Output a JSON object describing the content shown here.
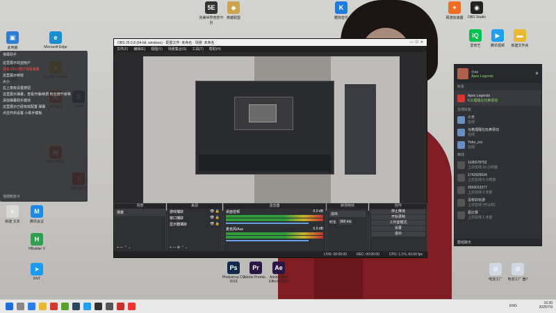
{
  "desktop_icons": [
    {
      "label": "此电脑",
      "color": "#2d7dd2",
      "glyph": "▣",
      "pos": "a"
    },
    {
      "label": "Microsoft Edge",
      "color": "#1a8fce",
      "glyph": "e",
      "pos": "b"
    },
    {
      "label": "回收站",
      "color": "#6f7c8a",
      "glyph": "♻",
      "pos": "c"
    },
    {
      "label": "Google Chrome",
      "color": "#d9a21b",
      "glyph": "●",
      "pos": "d"
    },
    {
      "label": "火绒安全",
      "color": "#c9572e",
      "glyph": "火",
      "pos": "e"
    },
    {
      "label": "Steam",
      "color": "#2a475e",
      "glyph": "S",
      "pos": "f"
    },
    {
      "label": "WPS Office",
      "color": "#d23a2f",
      "glyph": "W",
      "pos": "g"
    },
    {
      "label": "网易云音乐",
      "color": "#c5302c",
      "glyph": "♫",
      "pos": "h"
    },
    {
      "label": "新建 文本",
      "color": "#d9d9d9",
      "glyph": "≡",
      "pos": "i"
    },
    {
      "label": "腾讯会议",
      "color": "#1e88e5",
      "glyph": "M",
      "pos": "j"
    },
    {
      "label": "HBuilder X",
      "color": "#2e9e4f",
      "glyph": "H",
      "pos": "k"
    },
    {
      "label": "KNT",
      "color": "#1d9bf0",
      "glyph": "➤",
      "pos": "l"
    },
    {
      "label": "酷狗音乐",
      "color": "#1f7be0",
      "glyph": "K",
      "pos": "m"
    },
    {
      "label": "完美世界竞技平台",
      "color": "#333",
      "glyph": "5E",
      "pos": "n"
    },
    {
      "label": "英雄联盟",
      "color": "#c9a64d",
      "glyph": "◆",
      "pos": "o"
    },
    {
      "label": "网游加速器",
      "color": "#ef6c22",
      "glyph": "✦",
      "pos": "p"
    },
    {
      "label": "OBS Studio",
      "color": "#222",
      "glyph": "◉",
      "pos": "q"
    },
    {
      "label": "爱奇艺",
      "color": "#00c050",
      "glyph": "iQ",
      "pos": "r"
    },
    {
      "label": "腾讯视频",
      "color": "#1fa0f0",
      "glyph": "▶",
      "pos": "s"
    },
    {
      "label": "新建文件夹",
      "color": "#e8b934",
      "glyph": "▬",
      "pos": "t"
    },
    {
      "label": "Photoshop CC 2019",
      "color": "#0f2a4a",
      "glyph": "Ps",
      "pos": "u"
    },
    {
      "label": "Adobe Premie...",
      "color": "#2a1545",
      "glyph": "Pr",
      "pos": "v"
    },
    {
      "label": "Adobe After Effects 2020",
      "color": "#2a1545",
      "glyph": "Ae",
      "pos": "w"
    },
    {
      "label": "电流工厂",
      "color": "#cfd8e2",
      "glyph": "⚙",
      "pos": "x"
    },
    {
      "label": "电流工厂 器?",
      "color": "#cfd8e2",
      "glyph": "⚙",
      "pos": "y"
    }
  ],
  "left_chat": {
    "title": "弹幕助手",
    "lines": [
      {
        "text": "这里展示欢迎用户",
        "red": false
      },
      {
        "text": "观看 LV10用户观看弹幕",
        "red": true
      },
      {
        "text": "这里展示特效",
        "red": false
      },
      {
        "text": "大小",
        "red": false
      },
      {
        "text": "右上角有设置按钮",
        "red": false
      },
      {
        "text": "这里展示弹幕，查看开播/续费 粉丝牌升级等",
        "red": false
      },
      {
        "text": "添加弹幕助手模块",
        "red": false
      },
      {
        "text": "这里展示已经有效配置 弹幕",
        "red": false
      },
      {
        "text": "点击开启设置 小助手模板",
        "red": false
      }
    ],
    "footer": "当前粉丝 0"
  },
  "obs": {
    "title": "OBS 25.0.8 (64-bit, windows) - 配置文件: 未命名 - 场景: 未命名",
    "menu": [
      "文件(F)",
      "编辑(E)",
      "视图(V)",
      "场景集合(S)",
      "工具(T)",
      "帮助(H)"
    ],
    "panels": {
      "scenes": "场景",
      "sources": "来源",
      "mixer": "混音器",
      "transitions": "转场特效",
      "controls": "控件"
    },
    "scene_item": "场景",
    "sources": [
      "游戏捕获",
      "窗口捕获",
      "显示器捕获"
    ],
    "mixer": [
      {
        "name": "桌面音频",
        "level": "0.0 dB"
      },
      {
        "name": "麦克风/Aux",
        "level": "0.0 dB"
      }
    ],
    "transition": "淡出",
    "duration_label": "时长",
    "duration": "300 ms",
    "controls": [
      "停止推流",
      "开始录制",
      "工作室模式",
      "设置",
      "退出"
    ],
    "status": [
      "LIVE: 00:00:00",
      "REC: 00:00:00",
      "CPU: 1.1%, 60.00 fps"
    ]
  },
  "chat_panel": {
    "username": "小zz",
    "game": "Apex Legends",
    "section1": "好友",
    "featured": {
      "title": "Apex Legends",
      "sub": "K头理睡在玩鼻梁动"
    },
    "section2": "在线好友",
    "online": [
      {
        "name": "小天",
        "status": "在线"
      },
      {
        "name": "马格理睡在玩鼻梁动",
        "status": "在线"
      },
      {
        "name": "Yoho_zzz",
        "status": "在线"
      }
    ],
    "section3": "离线",
    "offline": [
      {
        "name": "1185578753",
        "status": "上次在线 10 小时前"
      },
      {
        "name": "1742929534",
        "status": "上次在线 6 小时前"
      },
      {
        "name": "2656013277",
        "status": "上次在线 3 天前"
      },
      {
        "name": "没有好玩游",
        "status": "上次在线 (可以的)"
      },
      {
        "name": "看比赛",
        "status": "上次在线 1 天前"
      }
    ],
    "footer": "群组聊天"
  },
  "taskbar": {
    "lang": "ENG",
    "time": "16:30",
    "date": "2025/7/9"
  }
}
